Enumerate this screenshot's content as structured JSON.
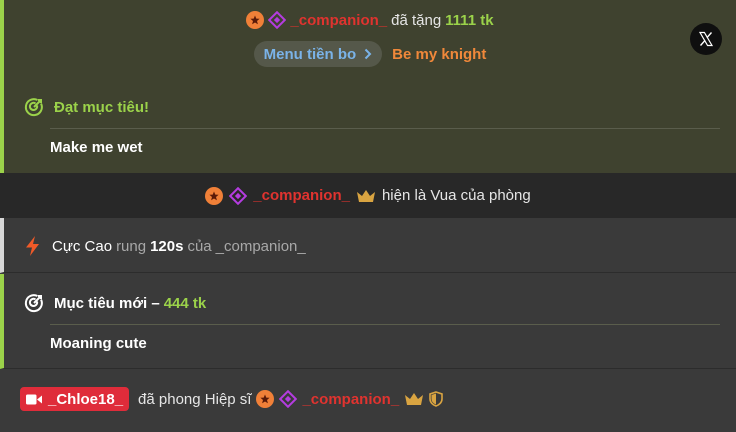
{
  "tip": {
    "username": "_companion_",
    "verb": "đã tặng",
    "amount": "1111 tk",
    "menu_label": "Menu tiền bo",
    "menu_item": "Be my knight"
  },
  "goal_reached": {
    "heading": "Đạt mục tiêu!",
    "text": "Make me wet"
  },
  "king": {
    "username": "_companion_",
    "text": "hiện là Vua của phòng"
  },
  "action": {
    "name": "Cực Cao",
    "verb": "rung",
    "duration": "120s",
    "of": "của",
    "username": "_companion_"
  },
  "new_goal": {
    "heading": "Mục tiêu mới –",
    "amount": "444 tk",
    "text": "Moaning cute"
  },
  "knight": {
    "model": "_Chloe18_",
    "text": "đã phong Hiệp sĩ",
    "username": "_companion_"
  },
  "colors": {
    "accent_green": "#9bd24a",
    "username_red": "#e0332f",
    "menu_orange": "#f0883a",
    "menu_blue": "#7ab3e8",
    "model_tag_red": "#df2c3a"
  },
  "icons": {
    "badges": [
      "star-badge-icon",
      "diamond-badge-icon"
    ],
    "goal": "target-icon",
    "action": "lightning-icon",
    "king": "crown-icon",
    "knight": "shield-icon",
    "close": "x-logo-icon",
    "camera": "camera-icon"
  }
}
